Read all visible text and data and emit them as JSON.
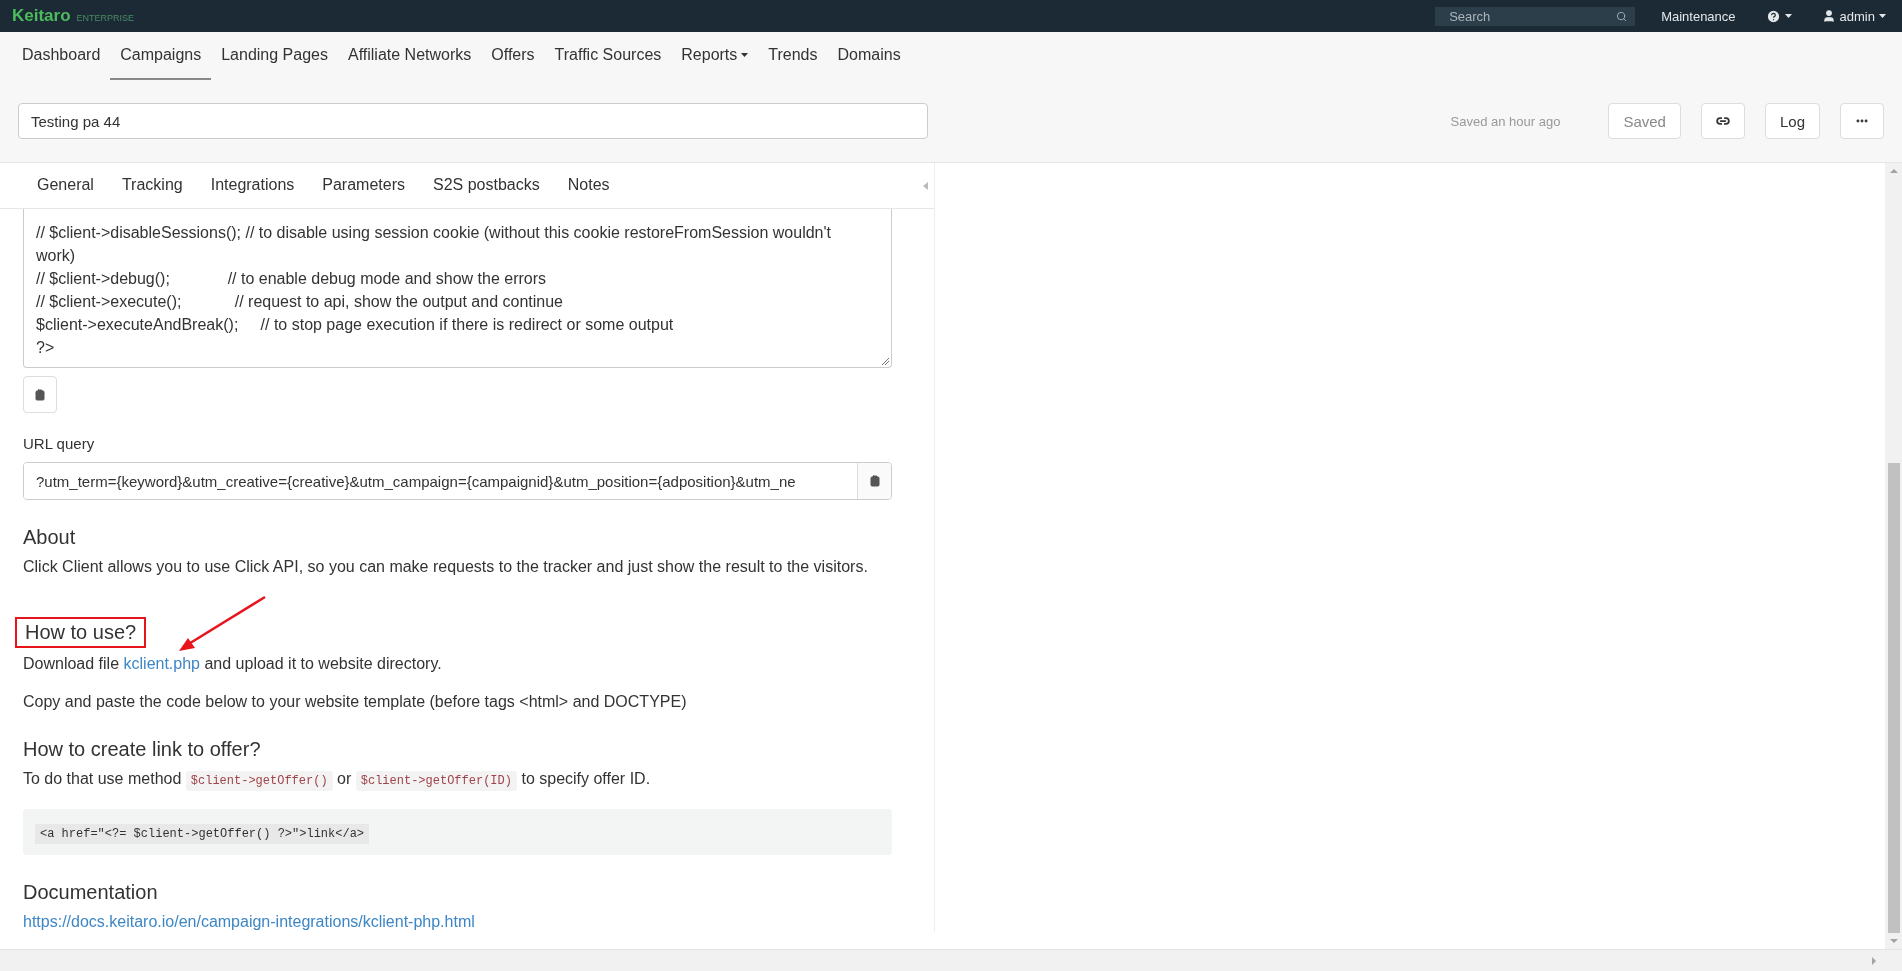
{
  "topbar": {
    "logo": "Keitaro",
    "edition": "ENTERPRISE",
    "search": {
      "placeholder": "Search"
    },
    "menu": "Maintenance",
    "user": "admin"
  },
  "nav": [
    {
      "label": "Dashboard",
      "selected": false,
      "dropdown": false
    },
    {
      "label": "Campaigns",
      "selected": true,
      "dropdown": false
    },
    {
      "label": "Landing Pages",
      "selected": false,
      "dropdown": false
    },
    {
      "label": "Affiliate Networks",
      "selected": false,
      "dropdown": false
    },
    {
      "label": "Offers",
      "selected": false,
      "dropdown": false
    },
    {
      "label": "Traffic Sources",
      "selected": false,
      "dropdown": false
    },
    {
      "label": "Reports",
      "selected": false,
      "dropdown": true
    },
    {
      "label": "Trends",
      "selected": false,
      "dropdown": false
    },
    {
      "label": "Domains",
      "selected": false,
      "dropdown": false
    }
  ],
  "header": {
    "campaign_name": "Testing pa 44",
    "status": "Saved an hour ago",
    "buttons": [
      {
        "kind": "text",
        "label": "Saved",
        "disabled": true
      },
      {
        "kind": "link",
        "disabled": false
      },
      {
        "kind": "text",
        "label": "Log",
        "disabled": false
      },
      {
        "kind": "more",
        "disabled": false
      }
    ]
  },
  "tabs": [
    {
      "label": "General",
      "selected": false
    },
    {
      "label": "Tracking",
      "selected": false
    },
    {
      "label": "Integrations",
      "selected": false
    },
    {
      "label": "Parameters",
      "selected": false
    },
    {
      "label": "S2S postbacks",
      "selected": false
    },
    {
      "label": "Notes",
      "selected": false
    }
  ],
  "code_lines": [
    "// $client->disableSessions(); // to disable using session cookie (without this cookie restoreFromSession wouldn't work)",
    "// $client->debug();             // to enable debug mode and show the errors",
    "// $client->execute();            // request to api, show the output and continue",
    "$client->executeAndBreak();     // to stop page execution if there is redirect or some output",
    "?>"
  ],
  "url_query": {
    "label": "URL query",
    "value": "?utm_term={keyword}&utm_creative={creative}&utm_campaign={campaignid}&utm_position={adposition}&utm_ne"
  },
  "about": {
    "heading": "About",
    "text": "Click Client allows you to use Click API, so you can make requests to the tracker and just show the result to the visitors."
  },
  "how_to_use": {
    "heading": "How to use?",
    "highlighted": true,
    "download_before": "Download file",
    "download_link": "kclient.php",
    "download_after": "and upload it to website directory.",
    "instruction": "Copy and paste the code below to your website template (before tags <html> and DOCTYPE)"
  },
  "create_link": {
    "heading": "How to create link to offer?",
    "before": "To do that use method",
    "code_1": "$client->getOffer()",
    "between": "or",
    "code_2": "$client->getOffer(ID)",
    "after": "to specify offer ID.",
    "example": "<a href=\"<?= $client->getOffer() ?>\">link</a>"
  },
  "documentation": {
    "heading": "Documentation",
    "link": "https://docs.keitaro.io/en/campaign-integrations/kclient-php.html"
  }
}
